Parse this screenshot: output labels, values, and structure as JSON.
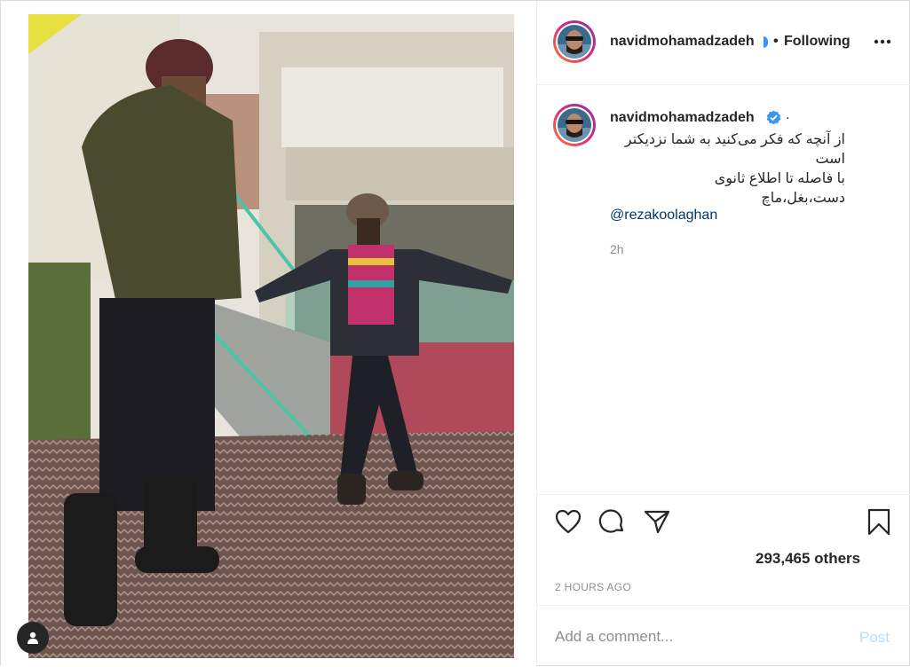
{
  "post": {
    "username": "navidmohamadzadeh",
    "follow_status": "Following",
    "separator": "•",
    "more_icon": "more-horizontal-icon"
  },
  "caption": {
    "username": "navidmohamadzadeh",
    "trailing": ".",
    "lines": [
      "از آنچه که فکر می‌کنید به شما نزدیکتر",
      "است",
      "با فاصله تا اطلاع ثانوی",
      "دست،بغل،ماچ"
    ],
    "mention": "@rezakoolaghan",
    "time": "2h"
  },
  "actions": {
    "likes_text": "293,465 others",
    "posted_ago": "2 HOURS AGO"
  },
  "comment": {
    "placeholder": "Add a comment...",
    "post_label": "Post"
  },
  "colors": {
    "verified": "#3897f0",
    "link": "#00376b",
    "post_disabled": "#b2dffc",
    "ring_start": "#f58529",
    "ring_end": "#8134af"
  }
}
